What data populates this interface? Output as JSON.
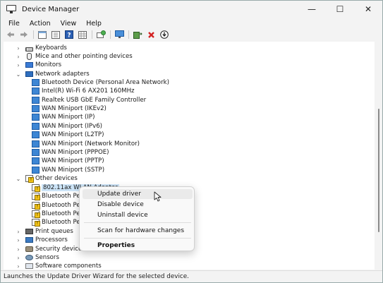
{
  "window": {
    "title": "Device Manager",
    "minimize_glyph": "—",
    "maximize_glyph": "☐",
    "close_glyph": "✕"
  },
  "menubar": {
    "items": [
      "File",
      "Action",
      "View",
      "Help"
    ]
  },
  "toolbar": {
    "buttons": [
      "back-arrow-icon",
      "forward-arrow-icon",
      "properties-window-icon",
      "tree-view-icon",
      "help-icon",
      "grid-view-icon",
      "scan-hardware-icon",
      "monitor-icon",
      "update-driver-icon",
      "uninstall-x-icon",
      "download-icon"
    ]
  },
  "tree": {
    "items": [
      {
        "label": "Keyboards",
        "chevron": ">",
        "icon": "keyboard-icon"
      },
      {
        "label": "Mice and other pointing devices",
        "chevron": ">",
        "icon": "mouse-icon"
      },
      {
        "label": "Monitors",
        "chevron": ">",
        "icon": "monitor-icon"
      },
      {
        "label": "Network adapters",
        "chevron": "v",
        "icon": "network-adapter-icon"
      },
      {
        "label": "Bluetooth Device (Personal Area Network)",
        "icon": "network-adapter-icon"
      },
      {
        "label": "Intel(R) Wi-Fi 6 AX201 160MHz",
        "icon": "network-adapter-icon"
      },
      {
        "label": "Realtek USB GbE Family Controller",
        "icon": "network-adapter-icon"
      },
      {
        "label": "WAN Miniport (IKEv2)",
        "icon": "network-adapter-icon"
      },
      {
        "label": "WAN Miniport (IP)",
        "icon": "network-adapter-icon"
      },
      {
        "label": "WAN Miniport (IPv6)",
        "icon": "network-adapter-icon"
      },
      {
        "label": "WAN Miniport (L2TP)",
        "icon": "network-adapter-icon"
      },
      {
        "label": "WAN Miniport (Network Monitor)",
        "icon": "network-adapter-icon"
      },
      {
        "label": "WAN Miniport (PPPOE)",
        "icon": "network-adapter-icon"
      },
      {
        "label": "WAN Miniport (PPTP)",
        "icon": "network-adapter-icon"
      },
      {
        "label": "WAN Miniport (SSTP)",
        "icon": "network-adapter-icon"
      },
      {
        "label": "Other devices",
        "chevron": "v",
        "icon": "unknown-device-icon"
      },
      {
        "label": "802.11ax WLAN Adapter",
        "icon": "warning-device-icon",
        "selected": true
      },
      {
        "label": "Bluetooth Per",
        "icon": "warning-device-icon"
      },
      {
        "label": "Bluetooth Per",
        "icon": "warning-device-icon"
      },
      {
        "label": "Bluetooth Per",
        "icon": "warning-device-icon"
      },
      {
        "label": "Bluetooth Per",
        "icon": "warning-device-icon"
      },
      {
        "label": "Print queues",
        "chevron": ">",
        "icon": "printer-icon"
      },
      {
        "label": "Processors",
        "chevron": ">",
        "icon": "processor-icon"
      },
      {
        "label": "Security devices",
        "chevron": ">",
        "icon": "security-device-icon"
      },
      {
        "label": "Sensors",
        "chevron": ">",
        "icon": "sensor-icon"
      },
      {
        "label": "Software components",
        "chevron": ">",
        "icon": "software-component-icon"
      }
    ]
  },
  "context_menu": {
    "items": [
      {
        "label": "Update driver",
        "hovered": true
      },
      {
        "label": "Disable device"
      },
      {
        "label": "Uninstall device"
      },
      {
        "label": "Scan for hardware changes"
      },
      {
        "label": "Properties",
        "bold": true
      }
    ]
  },
  "statusbar": {
    "text": "Launches the Update Driver Wizard for the selected device."
  },
  "colors": {
    "window_bg": "#f3f3f3",
    "tree_bg": "#ffffff",
    "selection": "#cce4f7",
    "menu_hover": "#eaeaea",
    "warning": "#f5c518"
  }
}
